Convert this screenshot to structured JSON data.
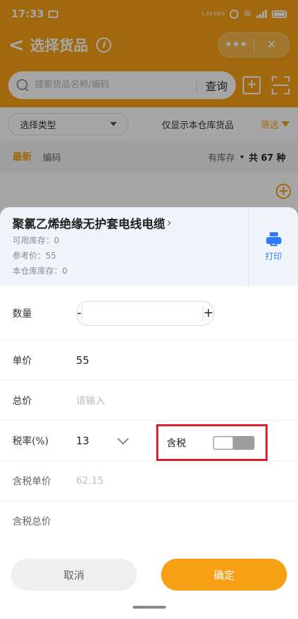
{
  "status_bar": {
    "time": "17:33",
    "net_speed": "1.63 KB/S"
  },
  "nav": {
    "back_icon": "chevron-left-icon",
    "title": "选择货品",
    "info_icon": "info-icon",
    "more_label": "•••",
    "close_label": "✕"
  },
  "search": {
    "placeholder": "搜索货品名称/编码",
    "value": "",
    "button_label": "查询"
  },
  "filter": {
    "type_select_label": "选择类型",
    "only_warehouse_label": "仅显示本仓库货品",
    "filter_label": "筛选"
  },
  "sort": {
    "latest_label": "最新",
    "code_label": "编码",
    "in_stock_label": "有库存",
    "total_label": "共 67 种"
  },
  "goods": {
    "name": "聚氯乙烯绝缘无护套电线电缆",
    "available_stock": "可用库存：0",
    "reference_price": "参考价：55",
    "warehouse_stock": "本仓库库存：0",
    "print_label": "打印"
  },
  "form": {
    "quantity_label": "数量",
    "quantity_minus": "-",
    "quantity_plus": "+",
    "quantity_value": "",
    "unit_price_label": "单价",
    "unit_price_value": "55",
    "total_price_label": "总价",
    "total_price_placeholder": "请输入",
    "tax_rate_label": "税率(%)",
    "tax_rate_value": "13",
    "tax_included_label": "含税",
    "tax_included_on": false,
    "taxed_unit_price_label": "含税单价",
    "taxed_unit_price_value": "62.15",
    "taxed_total_price_label": "含税总价",
    "taxed_total_price_value": ""
  },
  "buttons": {
    "cancel_label": "取消",
    "confirm_label": "确定"
  },
  "colors": {
    "accent": "#f7a015",
    "highlight_box": "#d8202a",
    "print_blue": "#2e7cf6"
  }
}
